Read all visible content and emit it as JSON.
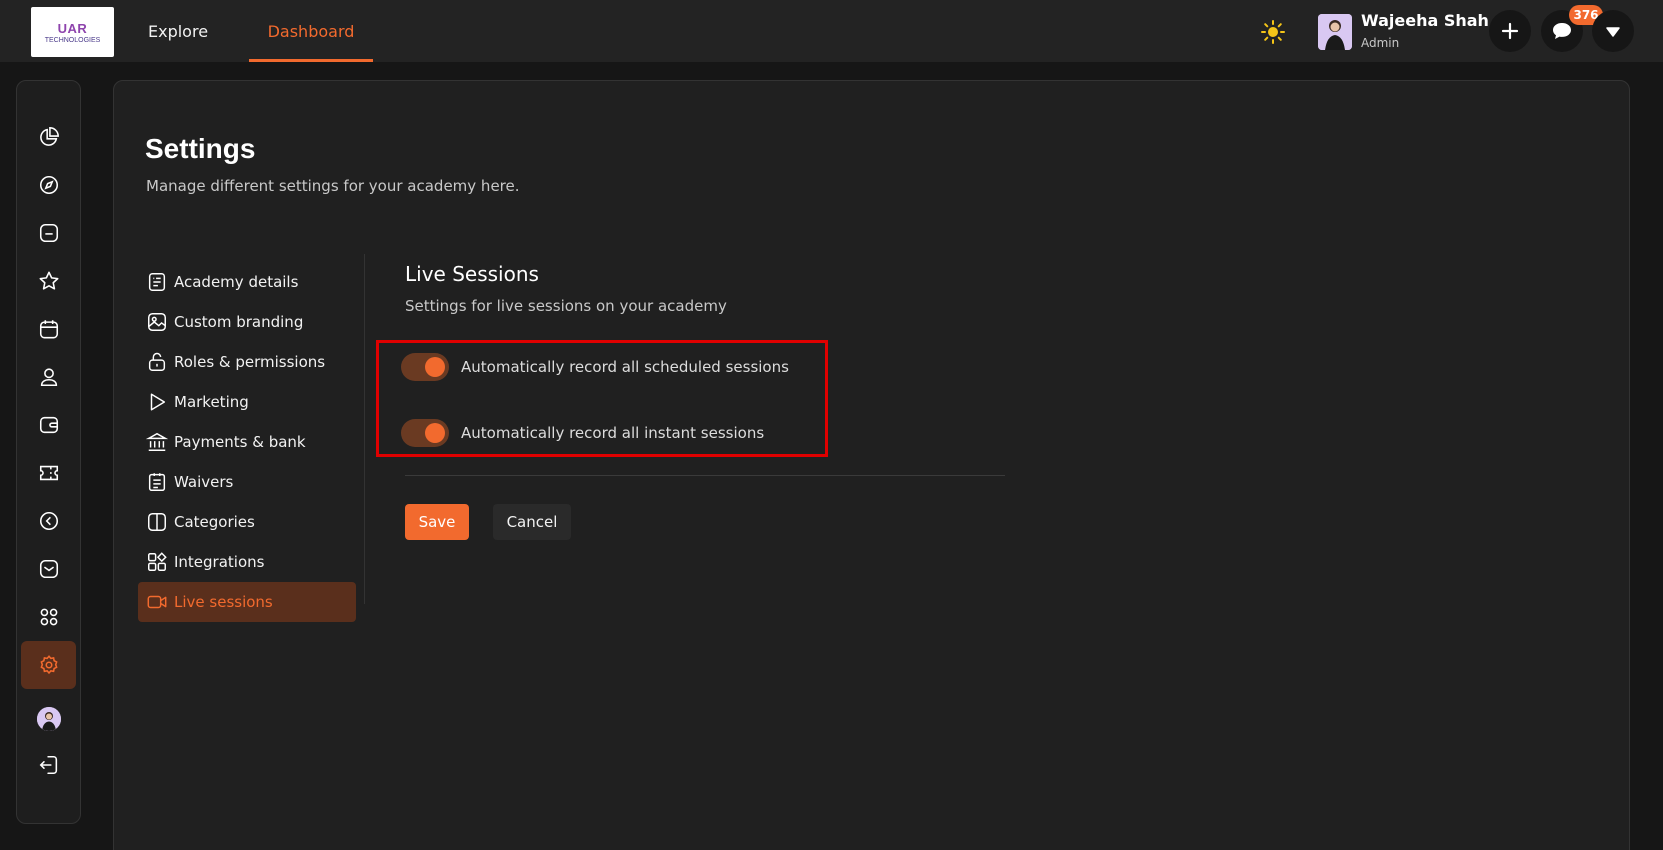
{
  "header": {
    "logo_text_primary": "UAR",
    "logo_text_secondary": "TECHNOLOGIES",
    "nav": [
      {
        "label": "Explore"
      },
      {
        "label": "Dashboard",
        "active": true
      }
    ],
    "user": {
      "name": "Wajeeha Shah",
      "role": "Admin"
    },
    "notification_count": "376",
    "accent_color": "#f26a2e"
  },
  "sidebar": {
    "icons": [
      "chart-pie-icon",
      "compass-icon",
      "folder-icon",
      "star-icon",
      "calendar-icon",
      "user-icon",
      "wallet-icon",
      "ticket-icon",
      "arrow-left-circle-icon",
      "mail-icon",
      "apps-icon",
      "gear-icon",
      "avatar",
      "logout-icon"
    ],
    "active": "gear-icon"
  },
  "page": {
    "title": "Settings",
    "subtitle": "Manage different settings for your academy here."
  },
  "settings_menu": {
    "items": [
      {
        "label": "Academy details",
        "icon": "document-list-icon"
      },
      {
        "label": "Custom branding",
        "icon": "image-icon"
      },
      {
        "label": "Roles & permissions",
        "icon": "lock-icon"
      },
      {
        "label": "Marketing",
        "icon": "play-icon"
      },
      {
        "label": "Payments & bank",
        "icon": "bank-icon"
      },
      {
        "label": "Waivers",
        "icon": "clipboard-icon"
      },
      {
        "label": "Categories",
        "icon": "columns-icon"
      },
      {
        "label": "Integrations",
        "icon": "shapes-icon"
      },
      {
        "label": "Live sessions",
        "icon": "video-icon",
        "active": true
      }
    ]
  },
  "live_sessions": {
    "title": "Live Sessions",
    "subtitle": "Settings for live sessions on your academy",
    "toggles": [
      {
        "label": "Automatically record all scheduled sessions",
        "on": true
      },
      {
        "label": "Automatically record all instant sessions",
        "on": true
      }
    ],
    "save_label": "Save",
    "cancel_label": "Cancel"
  }
}
